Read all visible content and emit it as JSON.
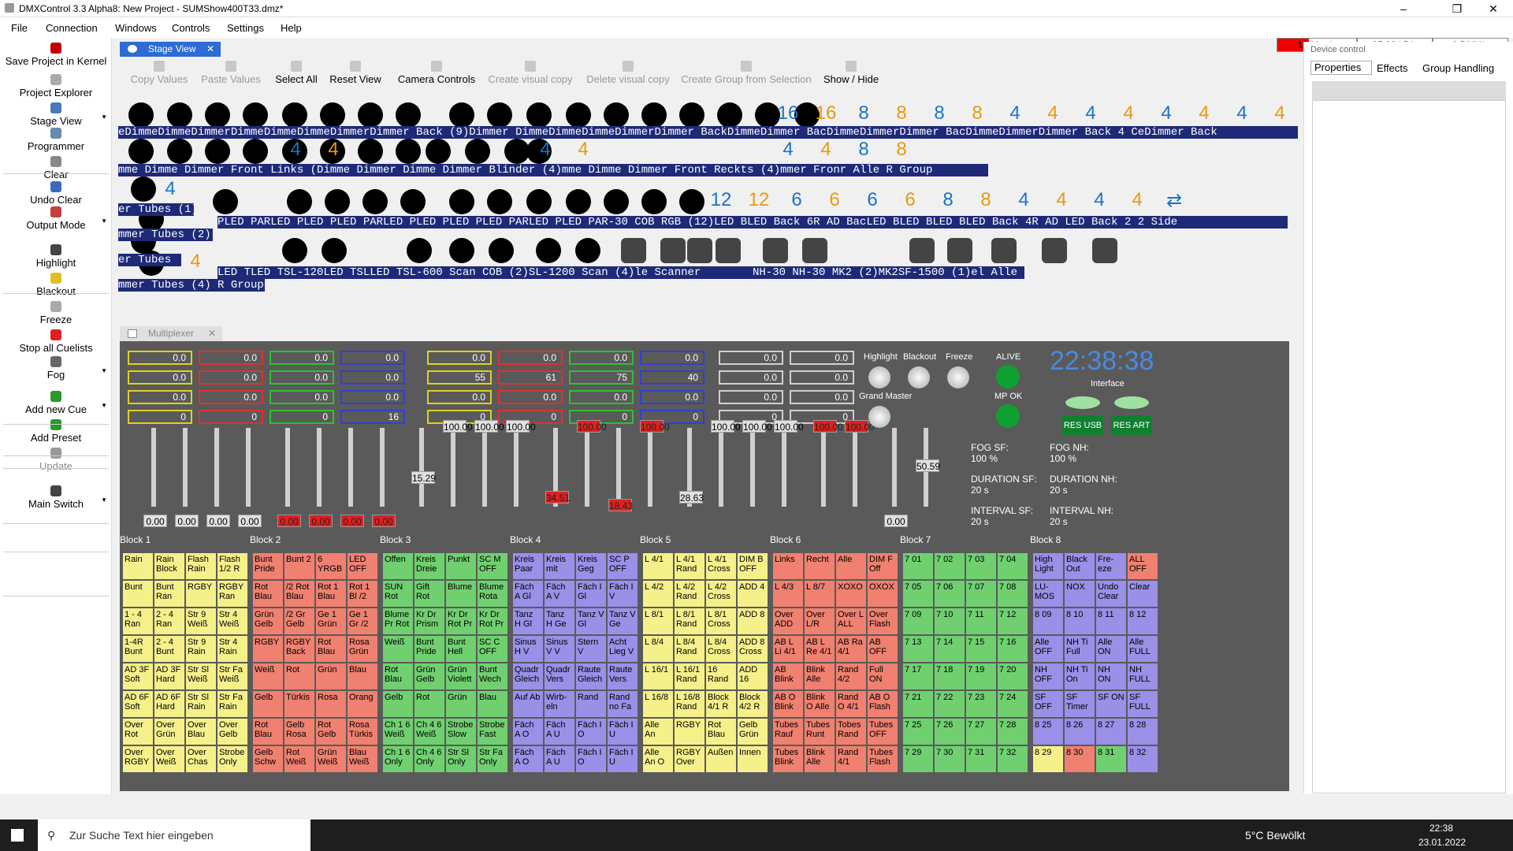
{
  "window": {
    "title": "DMXControl 3.3 Alpha8: New Project - SUMShow400T33.dmz*"
  },
  "menu": [
    "File",
    "Connection",
    "Windows",
    "Controls",
    "Settings",
    "Help"
  ],
  "stats": {
    "msgs": "15 Msg/s",
    "kbs": "35.83 kB/s",
    "dmx": "0 DMX/s"
  },
  "left": [
    {
      "label": "Save Project in Kernel",
      "icon": "save-icon",
      "color": "#c00000"
    },
    {
      "label": "Project Explorer",
      "icon": "explorer-icon",
      "color": "#aaa"
    },
    {
      "label": "Stage View",
      "icon": "stage-icon",
      "color": "#4a7ab8"
    },
    {
      "label": "Programmer",
      "icon": "programmer-icon",
      "color": "#6a8ab0"
    },
    {
      "label": "Clear",
      "icon": "clear-icon",
      "color": "#888"
    },
    {
      "label": "Undo Clear",
      "icon": "undo-icon",
      "color": "#3a6ac0"
    },
    {
      "label": "Output Mode",
      "icon": "output-icon",
      "color": "#c04040"
    },
    {
      "label": "Highlight",
      "icon": "highlight-icon",
      "color": "#444"
    },
    {
      "label": "Blackout",
      "icon": "blackout-icon",
      "color": "#e0c020"
    },
    {
      "label": "Freeze",
      "icon": "freeze-icon",
      "color": "#aaa"
    },
    {
      "label": "Stop all Cuelists",
      "icon": "stop-icon",
      "color": "#e02020"
    },
    {
      "label": "Fog",
      "icon": "fog-icon",
      "color": "#666"
    },
    {
      "label": "Add new Cue",
      "icon": "add-cue-icon",
      "color": "#2a9a2a"
    },
    {
      "label": "Add Preset",
      "icon": "add-preset-icon",
      "color": "#2a9a2a"
    },
    {
      "label": "Update",
      "icon": "update-icon",
      "color": "#999"
    },
    {
      "label": "Main Switch",
      "icon": "main-switch-icon",
      "color": "#444"
    }
  ],
  "tabs": {
    "stage": "Stage View",
    "mplx": "Multiplexer"
  },
  "toolbar": [
    "Copy Values",
    "Paste Values",
    "Select All",
    "Reset View",
    "Camera Controls",
    "Create visual copy",
    "Delete visual copy",
    "Create Group from Selection",
    "Show / Hide"
  ],
  "stage": {
    "rows": [
      {
        "nums": [
          [
            "16",
            "#1a73c9"
          ],
          [
            "16",
            "#e89a10"
          ],
          [
            "8",
            "#1a73c9"
          ],
          [
            "8",
            "#e89a10"
          ],
          [
            "8",
            "#1a73c9"
          ],
          [
            "8",
            "#e89a10"
          ],
          [
            "4",
            "#1a73c9"
          ],
          [
            "4",
            "#e89a10"
          ],
          [
            "4",
            "#1a73c9"
          ],
          [
            "4",
            "#e89a10"
          ],
          [
            "4",
            "#1a73c9"
          ],
          [
            "4",
            "#e89a10"
          ],
          [
            "4",
            "#1a73c9"
          ],
          [
            "4",
            "#e89a10"
          ]
        ],
        "label": "eDimmeDimmeDimmerDimmeDimmeDimmeDimmerDimmer Back (9)Dimmer DimmeDimmeDimmeDimmerDimmer BackDimmeDimmer BacDimmeDimmerDimmer BacDimmeDimmerDimmer Back 4 CeDimmer Back"
      },
      {
        "label": "mme Dimme Dimmer Front Links (Dimme Dimmer Dimme Dimmer Blinder (4)mme Dimme Dimmer Front Reckts (4)mmer Fronr Alle R Group"
      },
      {
        "label": "PLED PARLED PLED PLED PARLED PLED PLED PLED PARLED PLED PAR-30 COB RGB (12)LED BLED Back 6R AD BacLED BLED BLED BLED Back 4R AD LED Back 2 2 Side"
      },
      {
        "label": "LED TLED TSL-120LED TSLLED TSL-600 Scan COB (2)SL-1200 Scan (4)le Scanner"
      }
    ],
    "side_labels": [
      "er Tubes (1)",
      "mmer Tubes (2)",
      "er Tubes",
      "mmer Tubes (4) R Group"
    ],
    "row2_nums": [
      [
        "4",
        "#1a73c9"
      ],
      [
        "4",
        "#e89a10"
      ],
      [
        "4",
        "#1a73c9"
      ],
      [
        "4",
        "#e89a10"
      ],
      [
        "4",
        "#1a73c9"
      ],
      [
        "4",
        "#e89a10"
      ],
      [
        "8",
        "#1a73c9"
      ],
      [
        "8",
        "#e89a10"
      ]
    ],
    "row3_nums": [
      [
        "12",
        "#1a73c9"
      ],
      [
        "12",
        "#e89a10"
      ],
      [
        "6",
        "#1a73c9"
      ],
      [
        "6",
        "#e89a10"
      ],
      [
        "6",
        "#1a73c9"
      ],
      [
        "6",
        "#e89a10"
      ],
      [
        "8",
        "#1a73c9"
      ],
      [
        "8",
        "#e89a10"
      ],
      [
        "4",
        "#1a73c9"
      ],
      [
        "4",
        "#e89a10"
      ],
      [
        "4",
        "#1a73c9"
      ],
      [
        "4",
        "#e89a10"
      ]
    ],
    "row4_label2": "NH-30 NH-30 MK2 (2)MK2SF-1500 (1)el Alle"
  },
  "mplx": {
    "meters": [
      {
        "color": "#e0d020",
        "vals": [
          "0.0",
          "0.0",
          "0.0",
          "0"
        ]
      },
      {
        "color": "#e03030",
        "vals": [
          "0.0",
          "0.0",
          "0.0",
          "0"
        ]
      },
      {
        "color": "#30c030",
        "vals": [
          "0.0",
          "0.0",
          "0.0",
          "0"
        ]
      },
      {
        "color": "#3040d0",
        "vals": [
          "0.0",
          "0.0",
          "0.0",
          "16"
        ]
      },
      {
        "color": "#e0d020",
        "vals": [
          "0.0",
          "55",
          "0.0",
          "0"
        ]
      },
      {
        "color": "#e03030",
        "vals": [
          "0.0",
          "61",
          "0.0",
          "0"
        ]
      },
      {
        "color": "#30c030",
        "vals": [
          "0.0",
          "75",
          "0.0",
          "0"
        ]
      },
      {
        "color": "#3040d0",
        "vals": [
          "0.0",
          "40",
          "0.0",
          "0"
        ]
      },
      {
        "color": "#d0d0d0",
        "vals": [
          "0.0",
          "0.0",
          "0.0",
          "0"
        ]
      },
      {
        "color": "#d0d0d0",
        "vals": [
          "0.0",
          "0.0",
          "0.0",
          "0"
        ]
      }
    ],
    "fader_vals": [
      "0.00",
      "0.00",
      "0.00",
      "0.00",
      "0.00",
      "0.00",
      "0.00",
      "0.00",
      "15.29",
      "100.00",
      "100.00",
      "100.00",
      "34.51",
      "100.00",
      "18.43",
      "100.00",
      "28.63",
      "100.00",
      "100.00",
      "100.00",
      "100.00",
      "100.00",
      "0.00",
      "50.59"
    ],
    "highlight": "Highlight",
    "blackout": "Blackout",
    "freeze": "Freeze",
    "grand": "Grand Master",
    "alive": "ALIVE",
    "mpok": "MP OK",
    "time": "22:38:38",
    "interface": "Interface",
    "resusb": "RES USB",
    "resart": "RES ART",
    "fog": [
      [
        "FOG SF:",
        "100 %"
      ],
      [
        "DURATION SF:",
        "20 s"
      ],
      [
        "INTERVAL SF:",
        "20 s"
      ],
      [
        "FOG NH:",
        "100 %"
      ],
      [
        "DURATION NH:",
        "20 s"
      ],
      [
        "INTERVAL NH:",
        "20 s"
      ]
    ],
    "blocks": [
      {
        "name": "Block 1",
        "color": "#f5f08a",
        "cells": [
          "Rain",
          "Rain Block",
          "Flash Rain",
          "Flash 1/2 R",
          "Bunt",
          "Bunt Ran",
          "RGBY",
          "RGBY Ran",
          "1 - 4 Ran",
          "2 - 4 Ran",
          "Str 9 Weiß",
          "Str 4 Weiß",
          "1-4R Bunt",
          "2 - 4 Bunt",
          "Str 9 Rain",
          "Str 4 Rain",
          "AD 3F Soft",
          "AD 3F Hard",
          "Str Sl Weiß",
          "Str Fa Weiß",
          "AD 6F Soft",
          "AD 6F Hard",
          "Str Sl Rain",
          "Str Fa Rain",
          "Over Rot",
          "Over Grün",
          "Over Blau",
          "Over Gelb",
          "Over RGBY",
          "Over Weiß",
          "Over Chas",
          "Strobe Only"
        ]
      },
      {
        "name": "Block 2",
        "color": "#f08070",
        "cells": [
          "Bunt Pride",
          "Bunt 2",
          "6 YRGB",
          "LED OFF",
          "Rot Blau",
          "/2 Rot Blau",
          "Rot 1 Blau",
          "Rot 1 Bl /2",
          "Grün Gelb",
          "/2 Gr Gelb",
          "Ge 1 Grün",
          "Ge 1 Gr /2",
          "RGBY",
          "RGBY Back",
          "Rot Blau",
          "Rosa Grün",
          "Weiß",
          "Rot",
          "Grün",
          "Blau",
          "Gelb",
          "Türkis",
          "Rosa",
          "Orang",
          "Rot Blau",
          "Gelb Rosa",
          "Rot Gelb",
          "Rosa Türkis",
          "Gelb Schw",
          "Rot Weiß",
          "Grün Weiß",
          "Blau Weiß"
        ]
      },
      {
        "name": "Block 3",
        "color": "#70d070",
        "cells": [
          "Offen",
          "Kreis Dreie",
          "Punkt",
          "SC M OFF",
          "SUN Rot",
          "Gift Rot",
          "Blume",
          "Blume Rota",
          "Blume Pr Rot",
          "Kr Dr Prism",
          "Kr Dr Rot Pr",
          "Kr Dr Rot Pr",
          "Weiß",
          "Bunt Pride",
          "Bunt Hell",
          "SC C OFF",
          "Rot Blau",
          "Grün Gelb",
          "Grün Violett",
          "Bunt Wech",
          "Gelb",
          "Rot",
          "Grün",
          "Blau",
          "Ch 1 6 Weiß",
          "Ch 4 6 Weiß",
          "Strobe Slow",
          "Strobe Fast",
          "Ch 1 6 Only",
          "Ch 4 6 Only",
          "Str Sl Only",
          "Str Fa Only"
        ]
      },
      {
        "name": "Block 4",
        "color": "#9a90e8",
        "cells": [
          "Kreis Paar",
          "Kreis mit",
          "Kreis Geg",
          "SC P OFF",
          "Fäch A Gl",
          "Fäch A V",
          "Fäch I Gl",
          "Fäch I V",
          "Tanz H Gl",
          "Tanz H Ge",
          "Tanz V Gl",
          "Tanz V Ge",
          "Sinus H V",
          "Sinus V V",
          "Stern V",
          "Acht Lieg V",
          "Quadr Gleich",
          "Quadr Vers",
          "Raute Gleich",
          "Raute Vers",
          "Auf Ab",
          "Wirb-eln",
          "Rand",
          "Rand no Fa",
          "Fäch A O",
          "Fäch A U",
          "Fäch I O",
          "Fäch I U",
          "Fäch A O",
          "Fäch A U",
          "Fäch I O",
          "Fäch I U"
        ]
      },
      {
        "name": "Block 5",
        "color": "#f5f08a",
        "cells": [
          "L 4/1",
          "L 4/1 Rand",
          "L 4/1 Cross",
          "DIM B OFF",
          "L 4/2",
          "L 4/2 Rand",
          "L 4/2 Cross",
          "ADD 4",
          "L 8/1",
          "L 8/1 Rand",
          "L 8/1 Cross",
          "ADD 8",
          "L 8/4",
          "L 8/4 Rand",
          "L 8/4 Cross",
          "ADD 8 Cross",
          "L 16/1",
          "L 16/1 Rand",
          "16 Rand",
          "ADD 16",
          "L 16/8",
          "L 16/8 Rand",
          "Block 4/1 R",
          "Block 4/2 R",
          "Alle An",
          "RGBY",
          "Rot Blau",
          "Gelb Grün",
          "Alle An O",
          "RGBY Over",
          "Außen",
          "Innen"
        ]
      },
      {
        "name": "Block 6",
        "color": "#f08070",
        "cells": [
          "Links",
          "Recht",
          "Alle",
          "DIM F Off",
          "L 4/3",
          "L 8/7",
          "XOXO",
          "OXOX",
          "Over ADD",
          "Over L/R",
          "Over L ALL",
          "Over Flash",
          "AB L Li 4/1",
          "AB L Re 4/1",
          "AB Ra 4/1",
          "AB OFF",
          "AB Blink",
          "Blink Alle",
          "Rand 4/2",
          "Full ON",
          "AB O Blink",
          "Blink O Alle",
          "Rand O 4/1",
          "AB O Flash",
          "Tubes Rauf",
          "Tubes Runt",
          "Tobes Rand",
          "Tubes OFF",
          "Tubes Blink",
          "Blink Alle",
          "Rand 4/1",
          "Tubes Flash"
        ]
      },
      {
        "name": "Block 7",
        "color": "#70d070",
        "cells": [
          "7 01",
          "7 02",
          "7 03",
          "7 04",
          "7 05",
          "7 06",
          "7 07",
          "7 08",
          "7 09",
          "7 10",
          "7 11",
          "7 12",
          "7 13",
          "7 14",
          "7 15",
          "7 16",
          "7 17",
          "7 18",
          "7 19",
          "7 20",
          "7 21",
          "7 22",
          "7 23",
          "7 24",
          "7 25",
          "7 26",
          "7 27",
          "7 28",
          "7 29",
          "7 30",
          "7 31",
          "7 32"
        ]
      },
      {
        "name": "Block 8",
        "color": "#9a90e8",
        "cells": [
          "High Light",
          "Black Out",
          "Fre-eze",
          "ALL OFF",
          "LU-MOS",
          "NOX",
          "Undo Clear",
          "Clear",
          "8 09",
          "8 10",
          "8 11",
          "8 12",
          "Alle OFF",
          "NH Ti Full",
          "Alle ON",
          "Alle FULL",
          "NH OFF",
          "NH Ti On",
          "NH ON",
          "NH FULL",
          "SF OFF",
          "SF Timer",
          "SF ON",
          "SF FULL",
          "8 25",
          "8 26",
          "8 27",
          "8 28",
          "8 29",
          "8 30",
          "8 31",
          "8 32"
        ]
      }
    ]
  },
  "right": {
    "title": "Device control",
    "tabs": [
      "Properties",
      "Effects",
      "Group Handling"
    ]
  },
  "taskbar": {
    "search": "Zur Suche Text hier eingeben",
    "weather": "5°C Bewölkt",
    "time": "22:38",
    "date": "23.01.2022"
  }
}
